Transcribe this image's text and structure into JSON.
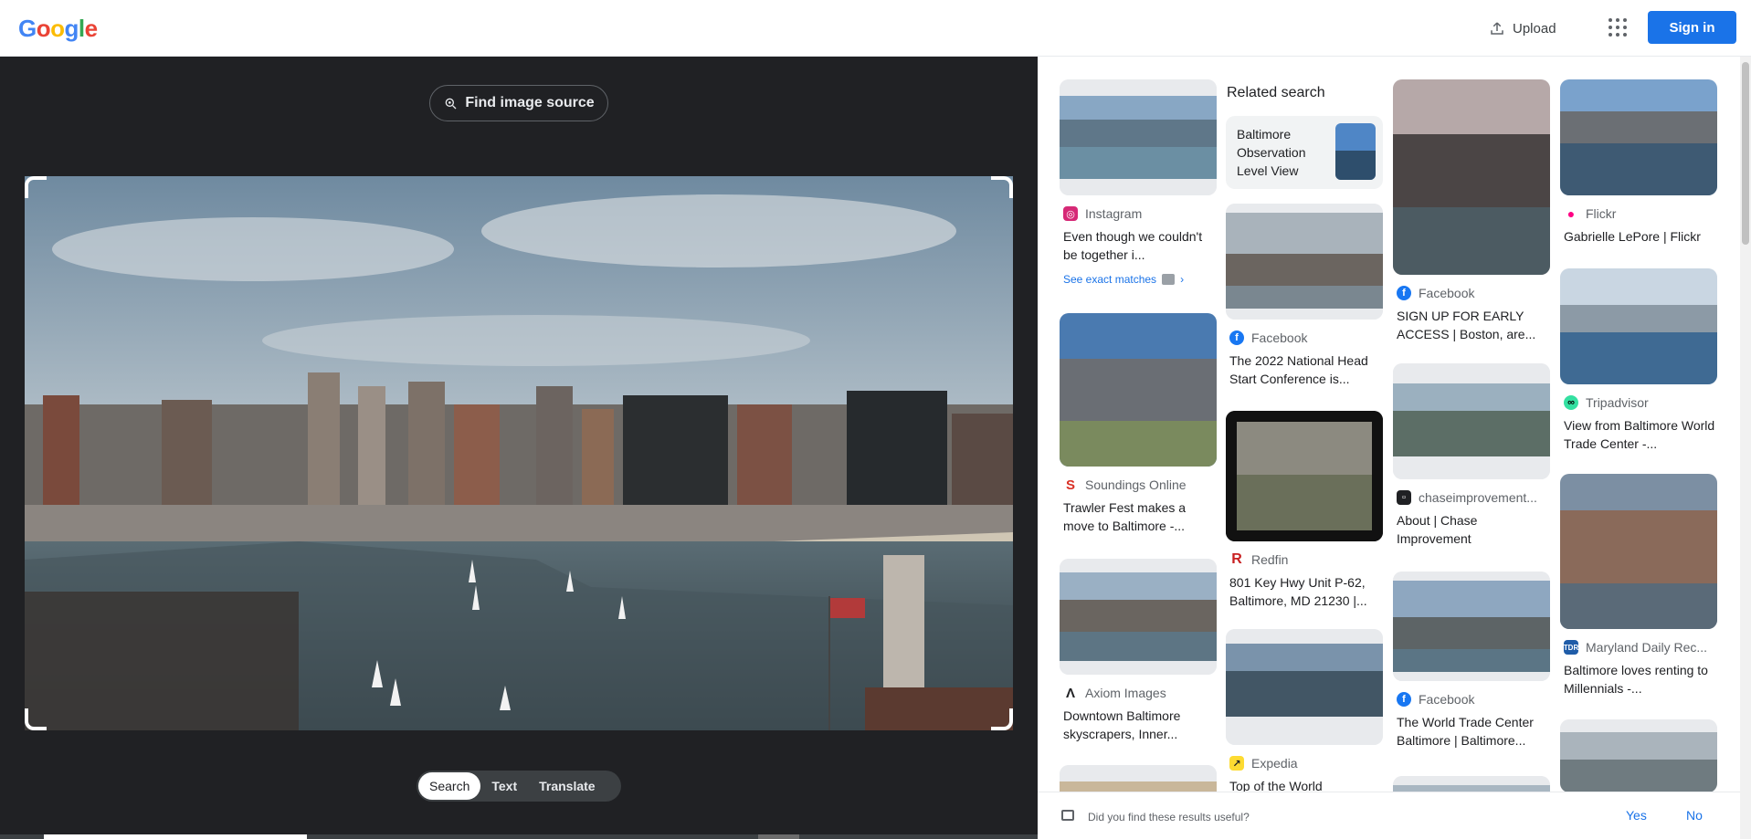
{
  "header": {
    "logo_letters": [
      "G",
      "o",
      "o",
      "g",
      "l",
      "e"
    ],
    "upload_label": "Upload",
    "apps_icon": "apps-grid-icon",
    "signin_label": "Sign in",
    "colors": {
      "accent": "#1a73e8"
    }
  },
  "viewer": {
    "find_source_label": "Find image source",
    "modes": [
      "Search",
      "Text",
      "Translate"
    ],
    "active_mode": "Search"
  },
  "results": {
    "related_title": "Related search",
    "related_item": "Baltimore Observation Level View",
    "see_exact": "See exact matches",
    "cards": [
      {
        "source": "Instagram",
        "title": "Even though we couldn't be together i..."
      },
      {
        "source": "Soundings Online",
        "title": "Trawler Fest makes a move to Baltimore -..."
      },
      {
        "source": "Axiom Images",
        "title": "Downtown Baltimore skyscrapers, Inner..."
      },
      {
        "source": "Facebook",
        "title": "The 2022 National Head Start Conference is..."
      },
      {
        "source": "Redfin",
        "title": "801 Key Hwy Unit P-62, Baltimore, MD 21230 |..."
      },
      {
        "source": "Expedia",
        "title": "Top of the World"
      },
      {
        "source": "Facebook",
        "title": "SIGN UP FOR EARLY ACCESS | Boston, are..."
      },
      {
        "source": "chaseimprovement...",
        "title": "About | Chase Improvement"
      },
      {
        "source": "Facebook",
        "title": "The World Trade Center Baltimore | Baltimore..."
      },
      {
        "source": "Flickr",
        "title": "Gabrielle LePore | Flickr"
      },
      {
        "source": "Tripadvisor",
        "title": "View from Baltimore World Trade Center -..."
      },
      {
        "source": "Maryland Daily Rec...",
        "title": "Baltimore loves renting to Millennials -..."
      }
    ]
  },
  "feedback": {
    "question": "Did you find these results useful?",
    "yes": "Yes",
    "no": "No"
  }
}
